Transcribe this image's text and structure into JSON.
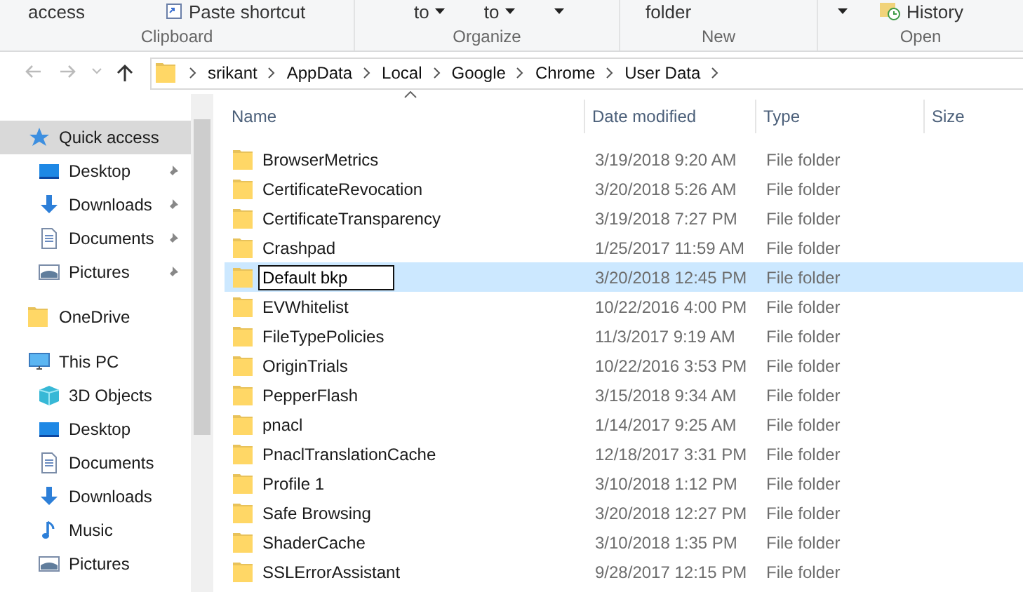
{
  "ribbon": {
    "groups": [
      {
        "label": "Clipboard",
        "items": [
          {
            "text": "access",
            "kind": "plain"
          },
          {
            "text": "Paste shortcut",
            "kind": "paste"
          }
        ]
      },
      {
        "label": "Organize",
        "items": [
          {
            "text": "to",
            "kind": "dropdown"
          },
          {
            "text": "to",
            "kind": "dropdown"
          },
          {
            "kind": "dropdown"
          }
        ]
      },
      {
        "label": "New",
        "items": [
          {
            "text": "folder",
            "kind": "plain"
          }
        ]
      },
      {
        "label": "Open",
        "items": [
          {
            "kind": "dropdown"
          },
          {
            "text": "History",
            "kind": "history"
          }
        ]
      }
    ]
  },
  "address": {
    "path": [
      "srikant",
      "AppData",
      "Local",
      "Google",
      "Chrome",
      "User Data"
    ]
  },
  "sidebar": {
    "items": [
      {
        "label": "Quick access",
        "kind": "star",
        "selected": true,
        "children": [
          {
            "label": "Desktop",
            "kind": "desktop",
            "pinned": true,
            "selected": false
          },
          {
            "label": "Downloads",
            "kind": "download",
            "pinned": true,
            "selected": false
          },
          {
            "label": "Documents",
            "kind": "document",
            "pinned": true,
            "selected": false
          },
          {
            "label": "Pictures",
            "kind": "pictures",
            "pinned": true,
            "selected": false
          }
        ]
      },
      {
        "label": "OneDrive",
        "kind": "folder",
        "selected": false
      },
      {
        "label": "This PC",
        "kind": "pc",
        "selected": false,
        "children": [
          {
            "label": "3D Objects",
            "kind": "cube",
            "pinned": false,
            "selected": false
          },
          {
            "label": "Desktop",
            "kind": "desktop",
            "pinned": false,
            "selected": false
          },
          {
            "label": "Documents",
            "kind": "document",
            "pinned": false,
            "selected": false
          },
          {
            "label": "Downloads",
            "kind": "download",
            "pinned": false,
            "selected": false
          },
          {
            "label": "Music",
            "kind": "music",
            "pinned": false,
            "selected": false
          },
          {
            "label": "Pictures",
            "kind": "pictures",
            "pinned": false,
            "selected": false
          }
        ]
      }
    ]
  },
  "table": {
    "columns": [
      "Name",
      "Date modified",
      "Type",
      "Size"
    ],
    "rows": [
      {
        "name": "BrowserMetrics",
        "date": "3/19/2018 9:20 AM",
        "type": "File folder",
        "selected": false,
        "editing": false
      },
      {
        "name": "CertificateRevocation",
        "date": "3/20/2018 5:26 AM",
        "type": "File folder",
        "selected": false,
        "editing": false
      },
      {
        "name": "CertificateTransparency",
        "date": "3/19/2018 7:27 PM",
        "type": "File folder",
        "selected": false,
        "editing": false
      },
      {
        "name": "Crashpad",
        "date": "1/25/2017 11:59 AM",
        "type": "File folder",
        "selected": false,
        "editing": false
      },
      {
        "name": "Default bkp",
        "date": "3/20/2018 12:45 PM",
        "type": "File folder",
        "selected": true,
        "editing": true
      },
      {
        "name": "EVWhitelist",
        "date": "10/22/2016 4:00 PM",
        "type": "File folder",
        "selected": false,
        "editing": false
      },
      {
        "name": "FileTypePolicies",
        "date": "11/3/2017 9:19 AM",
        "type": "File folder",
        "selected": false,
        "editing": false
      },
      {
        "name": "OriginTrials",
        "date": "10/22/2016 3:53 PM",
        "type": "File folder",
        "selected": false,
        "editing": false
      },
      {
        "name": "PepperFlash",
        "date": "3/15/2018 9:34 AM",
        "type": "File folder",
        "selected": false,
        "editing": false
      },
      {
        "name": "pnacl",
        "date": "1/14/2017 9:25 AM",
        "type": "File folder",
        "selected": false,
        "editing": false
      },
      {
        "name": "PnaclTranslationCache",
        "date": "12/18/2017 3:31 PM",
        "type": "File folder",
        "selected": false,
        "editing": false
      },
      {
        "name": "Profile 1",
        "date": "3/10/2018 1:12 PM",
        "type": "File folder",
        "selected": false,
        "editing": false
      },
      {
        "name": "Safe Browsing",
        "date": "3/20/2018 12:27 PM",
        "type": "File folder",
        "selected": false,
        "editing": false
      },
      {
        "name": "ShaderCache",
        "date": "3/10/2018 1:35 PM",
        "type": "File folder",
        "selected": false,
        "editing": false
      },
      {
        "name": "SSLErrorAssistant",
        "date": "9/28/2017 12:15 PM",
        "type": "File folder",
        "selected": false,
        "editing": false
      }
    ]
  }
}
